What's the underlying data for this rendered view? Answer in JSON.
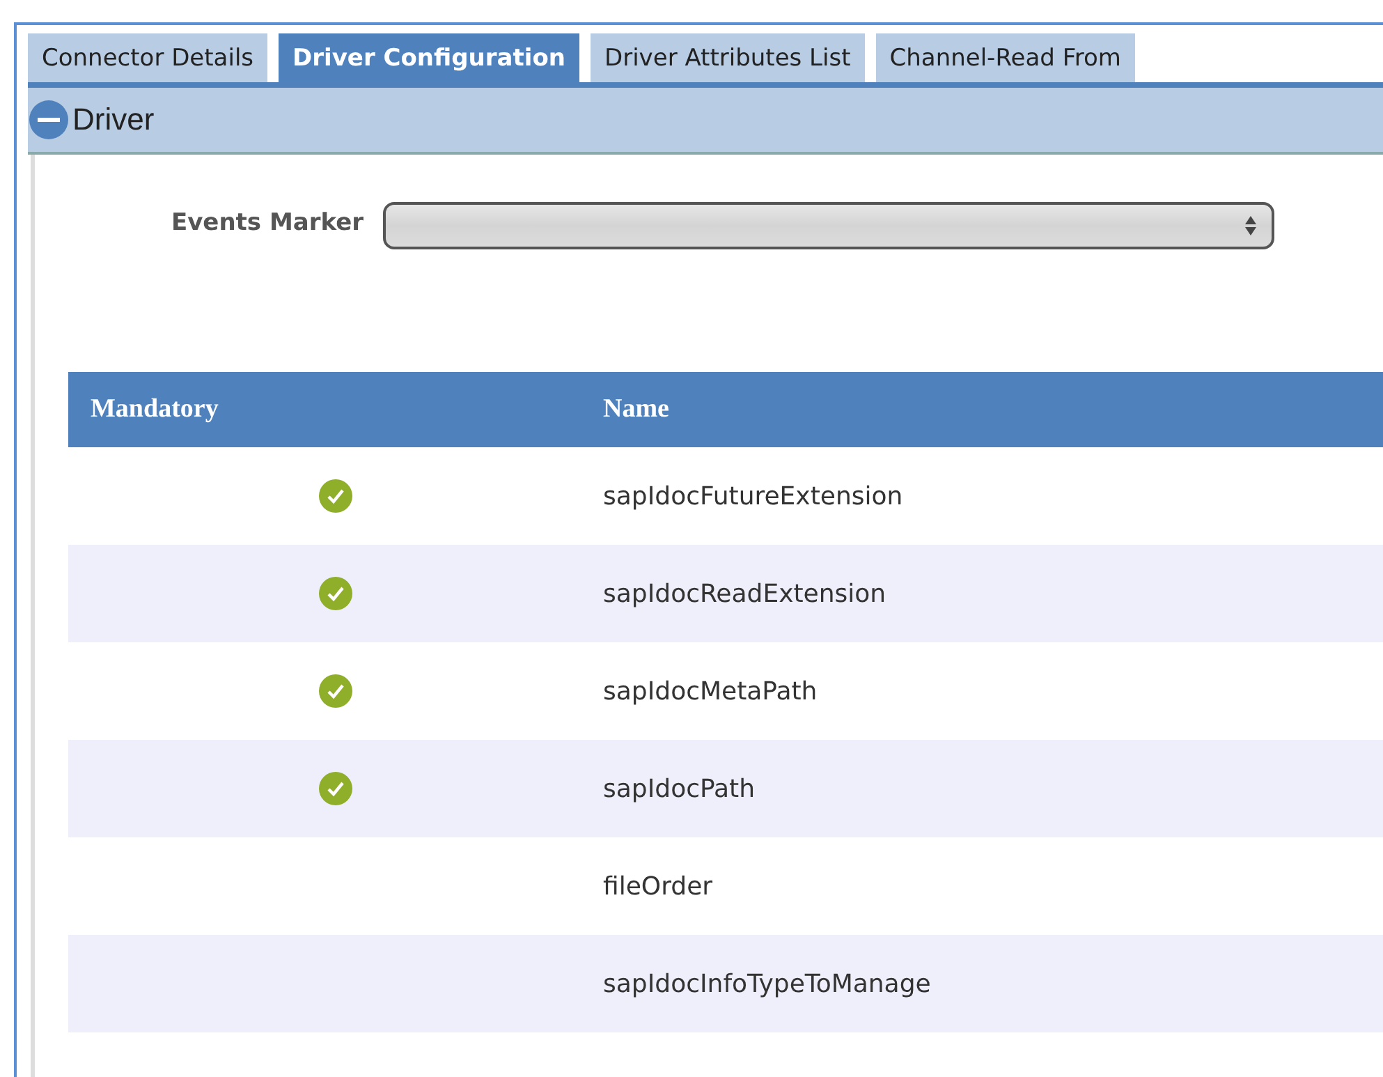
{
  "tabs": [
    {
      "label": "Connector Details",
      "selected": false
    },
    {
      "label": "Driver Configuration",
      "selected": true
    },
    {
      "label": "Driver Attributes List",
      "selected": false
    },
    {
      "label": "Channel-Read From",
      "selected": false
    }
  ],
  "section": {
    "title": "Driver",
    "expanded": true
  },
  "events_marker": {
    "label": "Events Marker"
  },
  "table": {
    "columns": [
      "Mandatory",
      "Name"
    ],
    "rows": [
      {
        "mandatory": true,
        "name": "sapIdocFutureExtension"
      },
      {
        "mandatory": true,
        "name": "sapIdocReadExtension"
      },
      {
        "mandatory": true,
        "name": "sapIdocMetaPath"
      },
      {
        "mandatory": true,
        "name": "sapIdocPath"
      },
      {
        "mandatory": false,
        "name": "fileOrder"
      },
      {
        "mandatory": false,
        "name": "sapIdocInfoTypeToManage"
      }
    ]
  }
}
